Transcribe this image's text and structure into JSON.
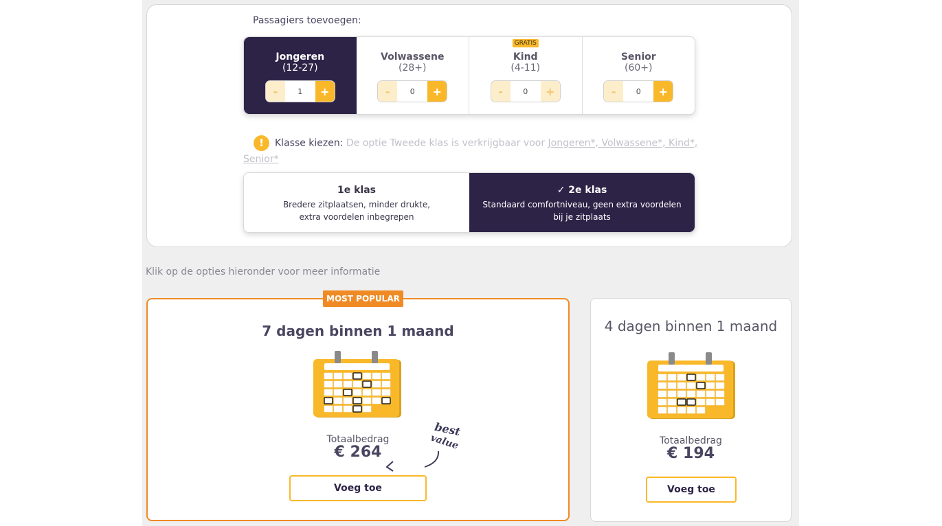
{
  "passengers": {
    "title": "Passagiers toevoegen:",
    "groups": [
      {
        "name": "Jongeren",
        "range": "(12-27)",
        "count": "1",
        "badge": "",
        "active": true
      },
      {
        "name": "Volwassene",
        "range": "(28+)",
        "count": "0",
        "badge": "",
        "active": false
      },
      {
        "name": "Kind",
        "range": "(4-11)",
        "count": "0",
        "badge": "GRATIS",
        "active": false
      },
      {
        "name": "Senior",
        "range": "(60+)",
        "count": "0",
        "badge": "",
        "active": false
      }
    ],
    "minus": "-",
    "plus": "+"
  },
  "class_choice": {
    "warning_icon": "!",
    "label": "Klasse kiezen:",
    "note_prefix": "De optie Tweede klas is verkrijgbaar voor",
    "note_link": "Jongeren*, Volwassene*, Kind*, Senior*",
    "options": [
      {
        "name": "1e klas",
        "desc": "Bredere zitplaatsen, minder drukte, extra voordelen inbegrepen",
        "selected": false
      },
      {
        "name": "2e klas",
        "check": "✓",
        "desc": "Standaard comfortniveau, geen extra voordelen bij je zitplaats",
        "selected": true
      }
    ]
  },
  "info_text": "Klik op de opties hieronder voor meer informatie",
  "offers": [
    {
      "badge": "MOST POPULAR",
      "title": "7 dagen binnen 1 maand",
      "total_label": "Totaalbedrag",
      "total": "€ 264",
      "button": "Voeg toe",
      "extra": "best value"
    },
    {
      "badge": "",
      "title": "4 dagen binnen 1 maand",
      "total_label": "Totaalbedrag",
      "total": "€ 194",
      "button": "Voeg toe"
    }
  ],
  "colors": {
    "accent": "#f9b82a",
    "dark": "#2d2347",
    "popular": "#f08a24"
  }
}
